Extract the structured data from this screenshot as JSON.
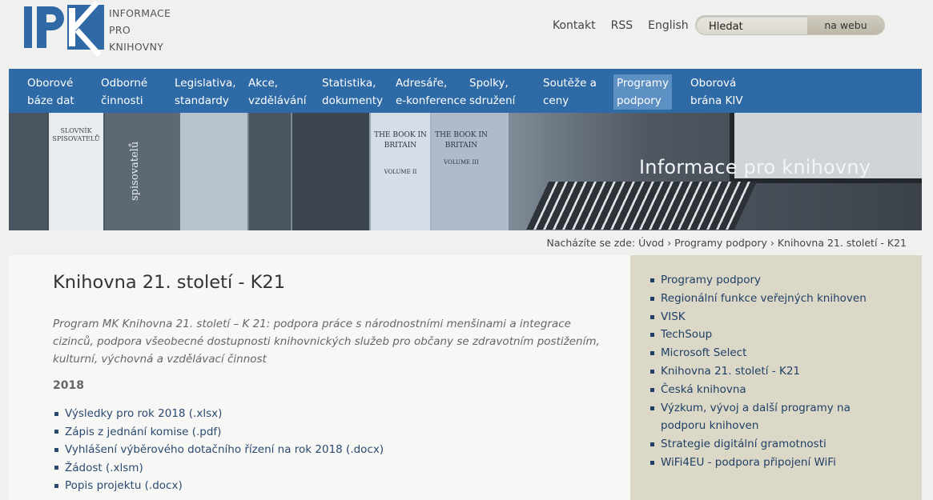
{
  "logo": {
    "letters": "IPK",
    "line1": "INFORMACE",
    "line2": "PRO",
    "line3": "KNIHOVNY"
  },
  "top_links": [
    "Kontakt",
    "RSS",
    "English"
  ],
  "search": {
    "placeholder": "Hledat",
    "button": "na webu"
  },
  "nav": [
    {
      "l1": "Oborové",
      "l2": "báze dat"
    },
    {
      "l1": "Odborné",
      "l2": "činnosti"
    },
    {
      "l1": "Legislativa,",
      "l2": "standardy"
    },
    {
      "l1": "Akce,",
      "l2": "vzdělávání"
    },
    {
      "l1": "Statistika,",
      "l2": "dokumenty"
    },
    {
      "l1": "Adresáře,",
      "l2": "e-konference"
    },
    {
      "l1": "Spolky,",
      "l2": "sdružení"
    },
    {
      "l1": "Soutěže a",
      "l2": "ceny"
    },
    {
      "l1": "Programy",
      "l2": "podpory",
      "active": true
    },
    {
      "l1": "Oborová",
      "l2": "brána KIV"
    }
  ],
  "banner": {
    "title": "Informace pro knihovny",
    "book_texts": [
      "SLOVNÍK SPISOVATELŮ",
      "spisovatelů",
      "THE BOOK IN BRITAIN",
      "VOLUME II",
      "THE BOOK IN BRITAIN",
      "VOLUME III"
    ]
  },
  "breadcrumb": "Nacházíte se zde: Úvod › Programy podpory › Knihovna 21. století - K21",
  "main": {
    "title": "Knihovna 21. století - K21",
    "intro": "Program MK Knihovna 21. století – K 21: podpora práce s národnostními menšinami a integrace cizinců, podpora všeobecné dostupnosti knihovnických služeb pro občany se zdravotním postižením, kulturní, výchovná a vzdělávací činnost",
    "year": "2018",
    "documents": [
      "Výsledky pro rok 2018 (.xlsx)",
      "Zápis z jednání komise (.pdf)",
      "Vyhlášení výběrového dotačního řízení na rok 2018 (.docx)",
      "Žádost (.xlsm)",
      "Popis projektu (.docx)"
    ]
  },
  "sidebar": {
    "items": [
      "Programy podpory",
      "Regionální funkce veřejných knihoven",
      "VISK",
      "TechSoup",
      "Microsoft Select",
      "Knihovna 21. století - K21",
      "Česká knihovna",
      "Výzkum, vývoj a další programy na podporu knihoven",
      "Strategie digitální gramotnosti",
      "WiFi4EU - podpora připojení WiFi"
    ]
  },
  "colors": {
    "nav_bg": "#2e6aa5",
    "nav_active": "#5c8fc2",
    "sidebar_bg": "#dbd8c7",
    "link": "#1f3f66"
  }
}
